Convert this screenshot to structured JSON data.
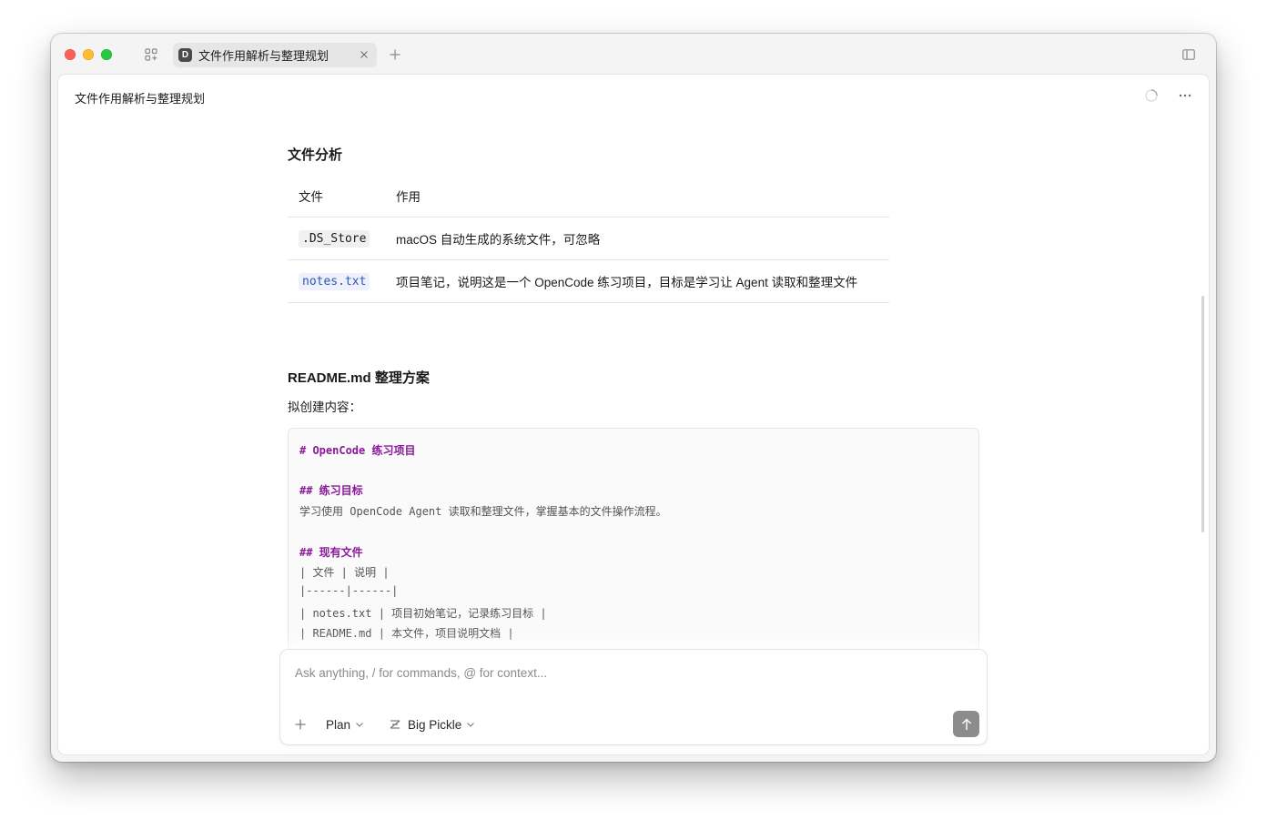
{
  "tab": {
    "badge": "D",
    "title": "文件作用解析与整理规划"
  },
  "panel": {
    "title": "文件作用解析与整理规划"
  },
  "file_analysis": {
    "heading": "文件分析",
    "columns": [
      "文件",
      "作用"
    ],
    "rows": [
      {
        "file": ".DS_Store",
        "desc": "macOS 自动生成的系统文件，可忽略"
      },
      {
        "file": "notes.txt",
        "desc": "项目笔记，说明这是一个 OpenCode 练习项目，目标是学习让 Agent 读取和整理文件"
      }
    ]
  },
  "readme_plan": {
    "heading": "README.md 整理方案",
    "label": "拟创建内容：",
    "code_lines": [
      "# OpenCode 练习项目",
      "",
      "## 练习目标",
      "学习使用 OpenCode Agent 读取和整理文件，掌握基本的文件操作流程。",
      "",
      "## 现有文件",
      "| 文件 | 说明 |",
      "|------|------|",
      "| notes.txt | 项目初始笔记，记录练习目标 |",
      "| README.md | 本文件，项目说明文档 |"
    ]
  },
  "composer": {
    "placeholder": "Ask anything, / for commands, @ for context...",
    "mode": "Plan",
    "model": "Big Pickle"
  },
  "colors": {
    "code_heading": "#8b1a9b",
    "inline_link_code": "#2d56b8",
    "send_button": "#8c8c8c"
  },
  "icons": [
    "grid-icon",
    "close-icon",
    "plus-icon",
    "sidebar-icon",
    "spinner-icon",
    "more-icon",
    "chevron-down-icon",
    "model-icon",
    "arrow-up-icon"
  ]
}
